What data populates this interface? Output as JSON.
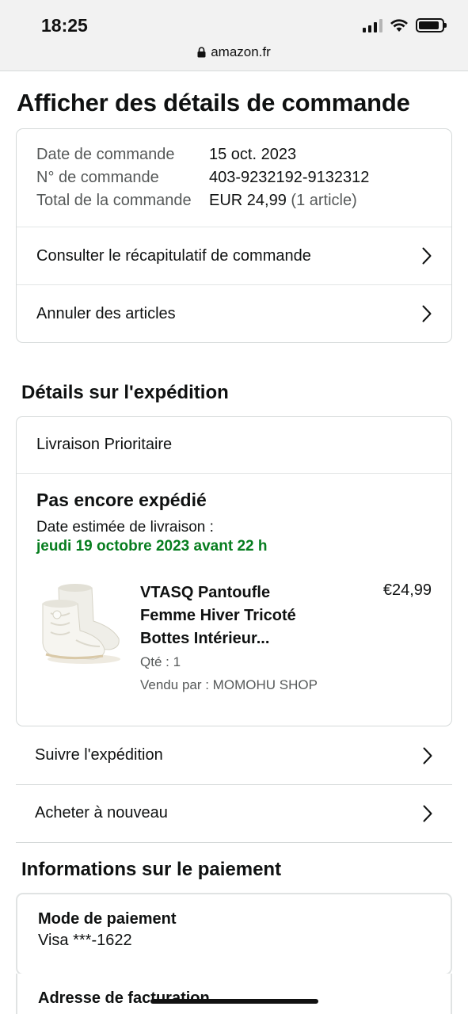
{
  "status_bar": {
    "time": "18:25",
    "url": "amazon.fr"
  },
  "page_title": "Afficher des détails de commande",
  "order_summary": {
    "rows": [
      {
        "label": "Date de commande",
        "value": "15 oct. 2023",
        "extra": ""
      },
      {
        "label": "N° de commande",
        "value": "403-9232192-9132312",
        "extra": ""
      },
      {
        "label": "Total de la commande",
        "value": "EUR 24,99",
        "extra": "(1 article)"
      }
    ],
    "links": [
      "Consulter le récapitulatif de commande",
      "Annuler des articles"
    ]
  },
  "shipping": {
    "section_title": "Détails sur l'expédition",
    "method": "Livraison Prioritaire",
    "status": "Pas encore expédié",
    "eta_label": "Date estimée de livraison :",
    "eta_date": "jeudi 19 octobre 2023 avant 22 h",
    "eta_color": "#067d1e",
    "product": {
      "title": "VTASQ Pantoufle Femme Hiver Tricoté Bottes Intérieur...",
      "price": "€24,99",
      "qty": "Qté : 1",
      "seller": "Vendu par : MOMOHU SHOP"
    },
    "links": [
      "Suivre l'expédition",
      "Acheter à nouveau"
    ]
  },
  "payment": {
    "section_title": "Informations sur le paiement",
    "method_label": "Mode de paiement",
    "method_value": "Visa ***-1622",
    "billing_label": "Adresse de facturation"
  }
}
